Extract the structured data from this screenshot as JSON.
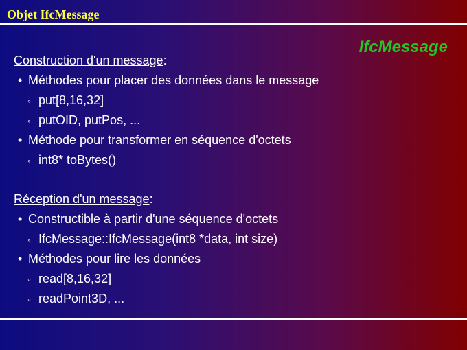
{
  "header": {
    "title": "Objet IfcMessage",
    "badge": "IfcMessage"
  },
  "sections": [
    {
      "title": "Construction d'un message",
      "title_suffix": ":",
      "items": [
        {
          "text": "Méthodes pour placer des données dans le message",
          "subitems": [
            "put[8,16,32]",
            "putOID, putPos, ..."
          ]
        },
        {
          "text": "Méthode pour transformer en séquence d'octets",
          "subitems": [
            "int8* toBytes()"
          ]
        }
      ]
    },
    {
      "title": "Réception d'un message",
      "title_suffix": ":",
      "items": [
        {
          "text": "Constructible à partir d'une séquence d'octets",
          "subitems": [
            "IfcMessage::IfcMessage(int8 *data, int size)"
          ]
        },
        {
          "text": "Méthodes pour lire les données",
          "subitems": [
            "read[8,16,32]",
            "readPoint3D, ..."
          ]
        }
      ]
    }
  ],
  "glyphs": {
    "bullet": "•",
    "sub_bullet": "◦"
  }
}
